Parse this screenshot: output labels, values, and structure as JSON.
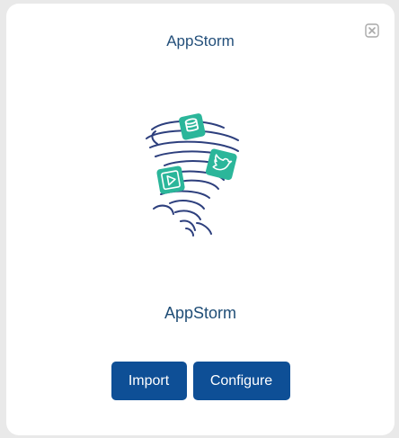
{
  "dialog": {
    "title": "AppStorm",
    "app_name": "AppStorm",
    "close_icon": "close-x-box-icon",
    "logo_icon": "tornado-apps-icon"
  },
  "actions": {
    "import_label": "Import",
    "configure_label": "Configure"
  },
  "colors": {
    "accent": "#0e4f96",
    "title_text": "#234f7a",
    "logo_green": "#2bb69a",
    "logo_lines": "#2d3f7d"
  }
}
